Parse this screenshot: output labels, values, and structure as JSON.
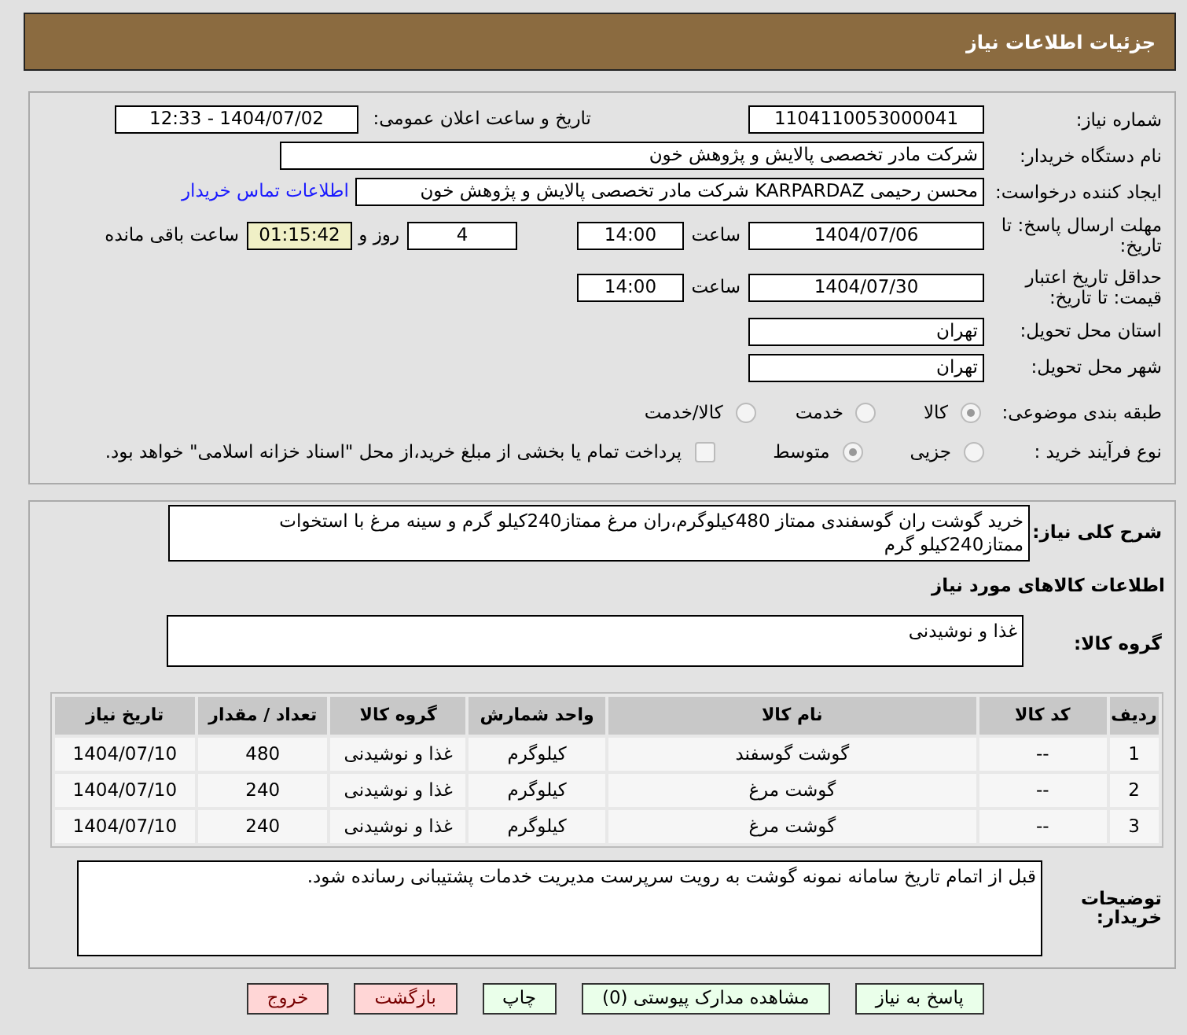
{
  "header": {
    "title": "جزئیات اطلاعات نیاز"
  },
  "need_number": {
    "label": "شماره نیاز:",
    "value": "1104110053000041"
  },
  "announce": {
    "label": "تاریخ و ساعت اعلان عمومی:",
    "value": "1404/07/02 - 12:33"
  },
  "buyer_org": {
    "label": "نام دستگاه خریدار:",
    "value": "شرکت مادر تخصصی پالایش و پژوهش خون"
  },
  "creator": {
    "label": "ایجاد کننده درخواست:",
    "value": "محسن رحیمی KARPARDAZ شرکت مادر تخصصی پالایش و پژوهش خون",
    "link": "اطلاعات تماس خریدار"
  },
  "deadline": {
    "label": "مهلت ارسال پاسخ: تا تاریخ:",
    "date": "1404/07/06",
    "time_label": "ساعت",
    "time": "14:00",
    "days": "4",
    "days_label": "روز و",
    "remaining": "01:15:42",
    "remaining_label": "ساعت باقی مانده"
  },
  "validity": {
    "label": "حداقل تاریخ اعتبار قیمت: تا تاریخ:",
    "date": "1404/07/30",
    "time_label": "ساعت",
    "time": "14:00"
  },
  "province": {
    "label": "استان محل تحویل:",
    "value": "تهران"
  },
  "city": {
    "label": "شهر محل تحویل:",
    "value": "تهران"
  },
  "category": {
    "label": "طبقه بندی موضوعی:",
    "options": [
      {
        "label": "کالا",
        "selected": true
      },
      {
        "label": "خدمت",
        "selected": false
      },
      {
        "label": "کالا/خدمت",
        "selected": false
      }
    ]
  },
  "process": {
    "label": "نوع فرآیند خرید :",
    "options": [
      {
        "label": "جزیی",
        "selected": false
      },
      {
        "label": "متوسط",
        "selected": true
      }
    ],
    "payment": {
      "label": "پرداخت تمام یا بخشی از مبلغ خرید،از محل \"اسناد خزانه اسلامی\" خواهد بود.",
      "checked": false
    }
  },
  "description": {
    "label": "شرح کلی نیاز:",
    "value": "خرید گوشت ران گوسفندی ممتاز 480کیلوگرم،ران مرغ ممتاز240کیلو گرم و سینه مرغ با استخوات ممتاز240کیلو گرم"
  },
  "goods_title": "اطلاعات کالاهای مورد نیاز",
  "goods_group": {
    "label": "گروه کالا:",
    "value": "غذا و نوشیدنی"
  },
  "table": {
    "columns": [
      "ردیف",
      "کد کالا",
      "نام کالا",
      "واحد شمارش",
      "گروه کالا",
      "تعداد / مقدار",
      "تاریخ نیاز"
    ],
    "rows": [
      [
        "1",
        "--",
        "گوشت گوسفند",
        "کیلوگرم",
        "غذا و نوشیدنی",
        "480",
        "1404/07/10"
      ],
      [
        "2",
        "--",
        "گوشت مرغ",
        "کیلوگرم",
        "غذا و نوشیدنی",
        "240",
        "1404/07/10"
      ],
      [
        "3",
        "--",
        "گوشت مرغ",
        "کیلوگرم",
        "غذا و نوشیدنی",
        "240",
        "1404/07/10"
      ]
    ]
  },
  "buyer_notes": {
    "label": "توضیحات خریدار:",
    "value": "قبل از اتمام تاریخ سامانه نمونه گوشت به رویت سرپرست مدیریت خدمات پشتیبانی رسانده شود."
  },
  "buttons": [
    {
      "label": "پاسخ به نیاز",
      "kind": "normal"
    },
    {
      "label": "مشاهده مدارک پیوستی (0)",
      "kind": "normal"
    },
    {
      "label": "چاپ",
      "kind": "normal"
    },
    {
      "label": "بازگشت",
      "kind": "danger"
    },
    {
      "label": "خروج",
      "kind": "danger"
    }
  ]
}
